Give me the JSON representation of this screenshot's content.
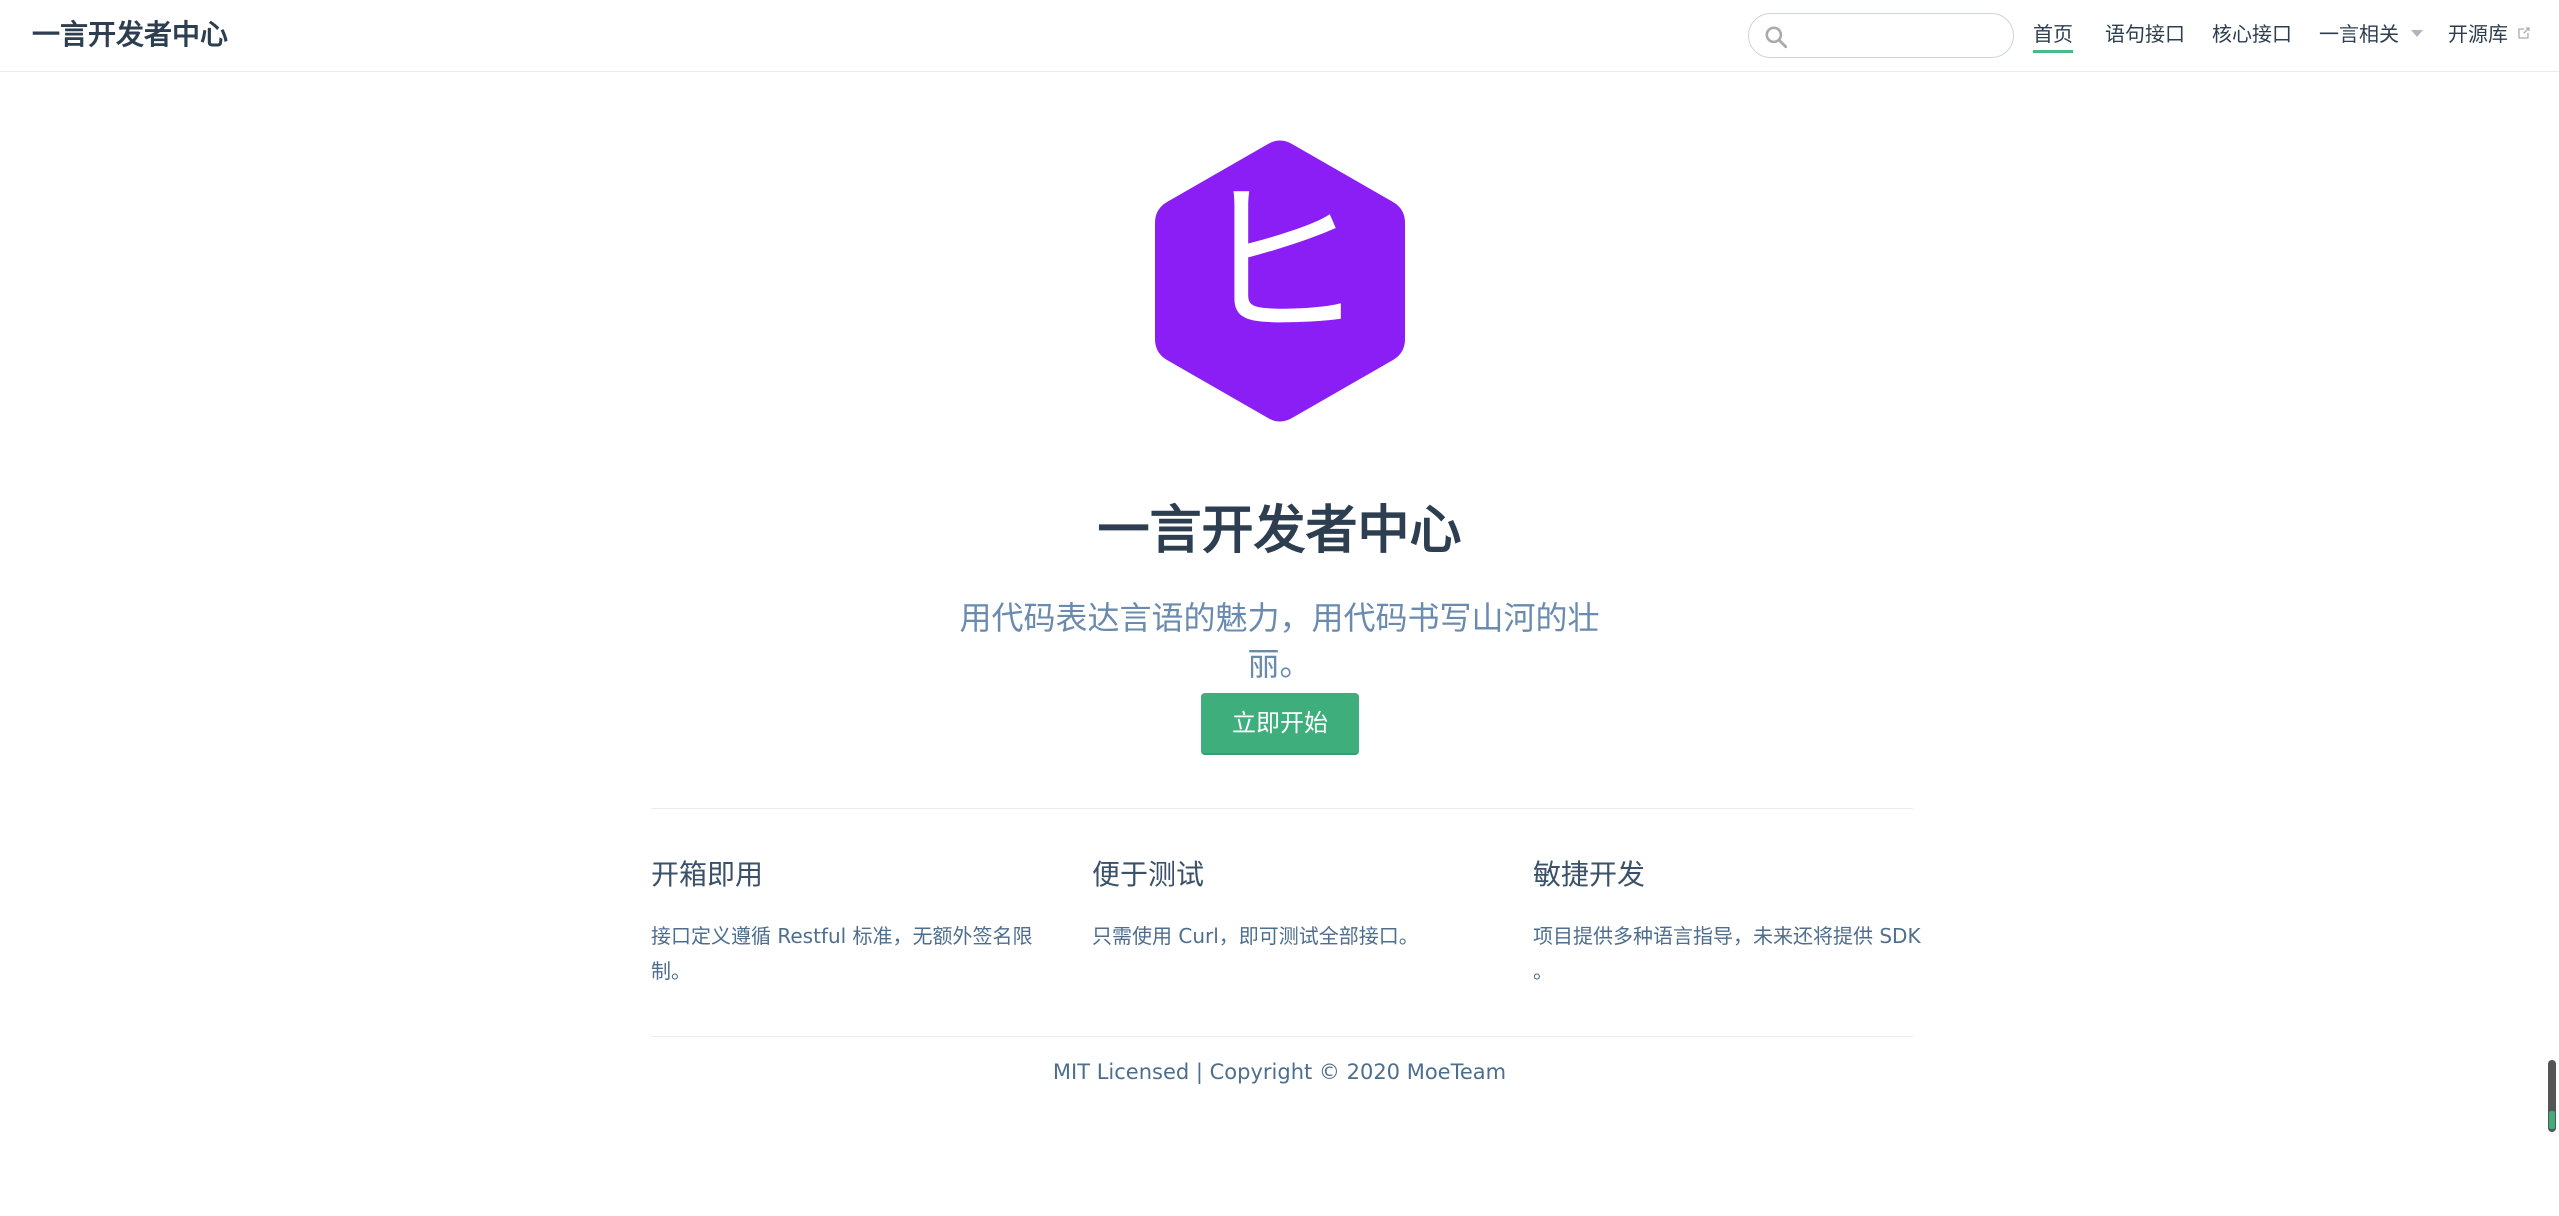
{
  "navbar": {
    "site_name": "一言开发者中心",
    "search": {
      "value": "",
      "placeholder": ""
    },
    "items": [
      {
        "label": "首页",
        "active": true
      },
      {
        "label": "语句接口"
      },
      {
        "label": "核心接口"
      },
      {
        "label": "一言相关",
        "dropdown": true
      },
      {
        "label": "开源库",
        "external": true
      }
    ]
  },
  "hero": {
    "logo_glyph": "ヒ",
    "logo_color": "#8b1df5",
    "title": "一言开发者中心",
    "description": "用代码表达言语的魅力，用代码书写山河的壮丽。",
    "action_label": "立即开始",
    "action_color": "#3eaf7c"
  },
  "features": [
    {
      "title": "开箱即用",
      "details": "接口定义遵循 Restful 标准，无额外签名限制。"
    },
    {
      "title": "便于测试",
      "details": "只需使用 Curl，即可测试全部接口。"
    },
    {
      "title": "敏捷开发",
      "details": "项目提供多种语言指导，未来还将提供 SDK 。"
    }
  ],
  "footer": {
    "text": "MIT Licensed | Copyright © 2020 MoeTeam"
  },
  "accent_color": "#3eaf7c",
  "icons": [
    "search-icon",
    "chevron-down-icon",
    "external-link-icon"
  ]
}
